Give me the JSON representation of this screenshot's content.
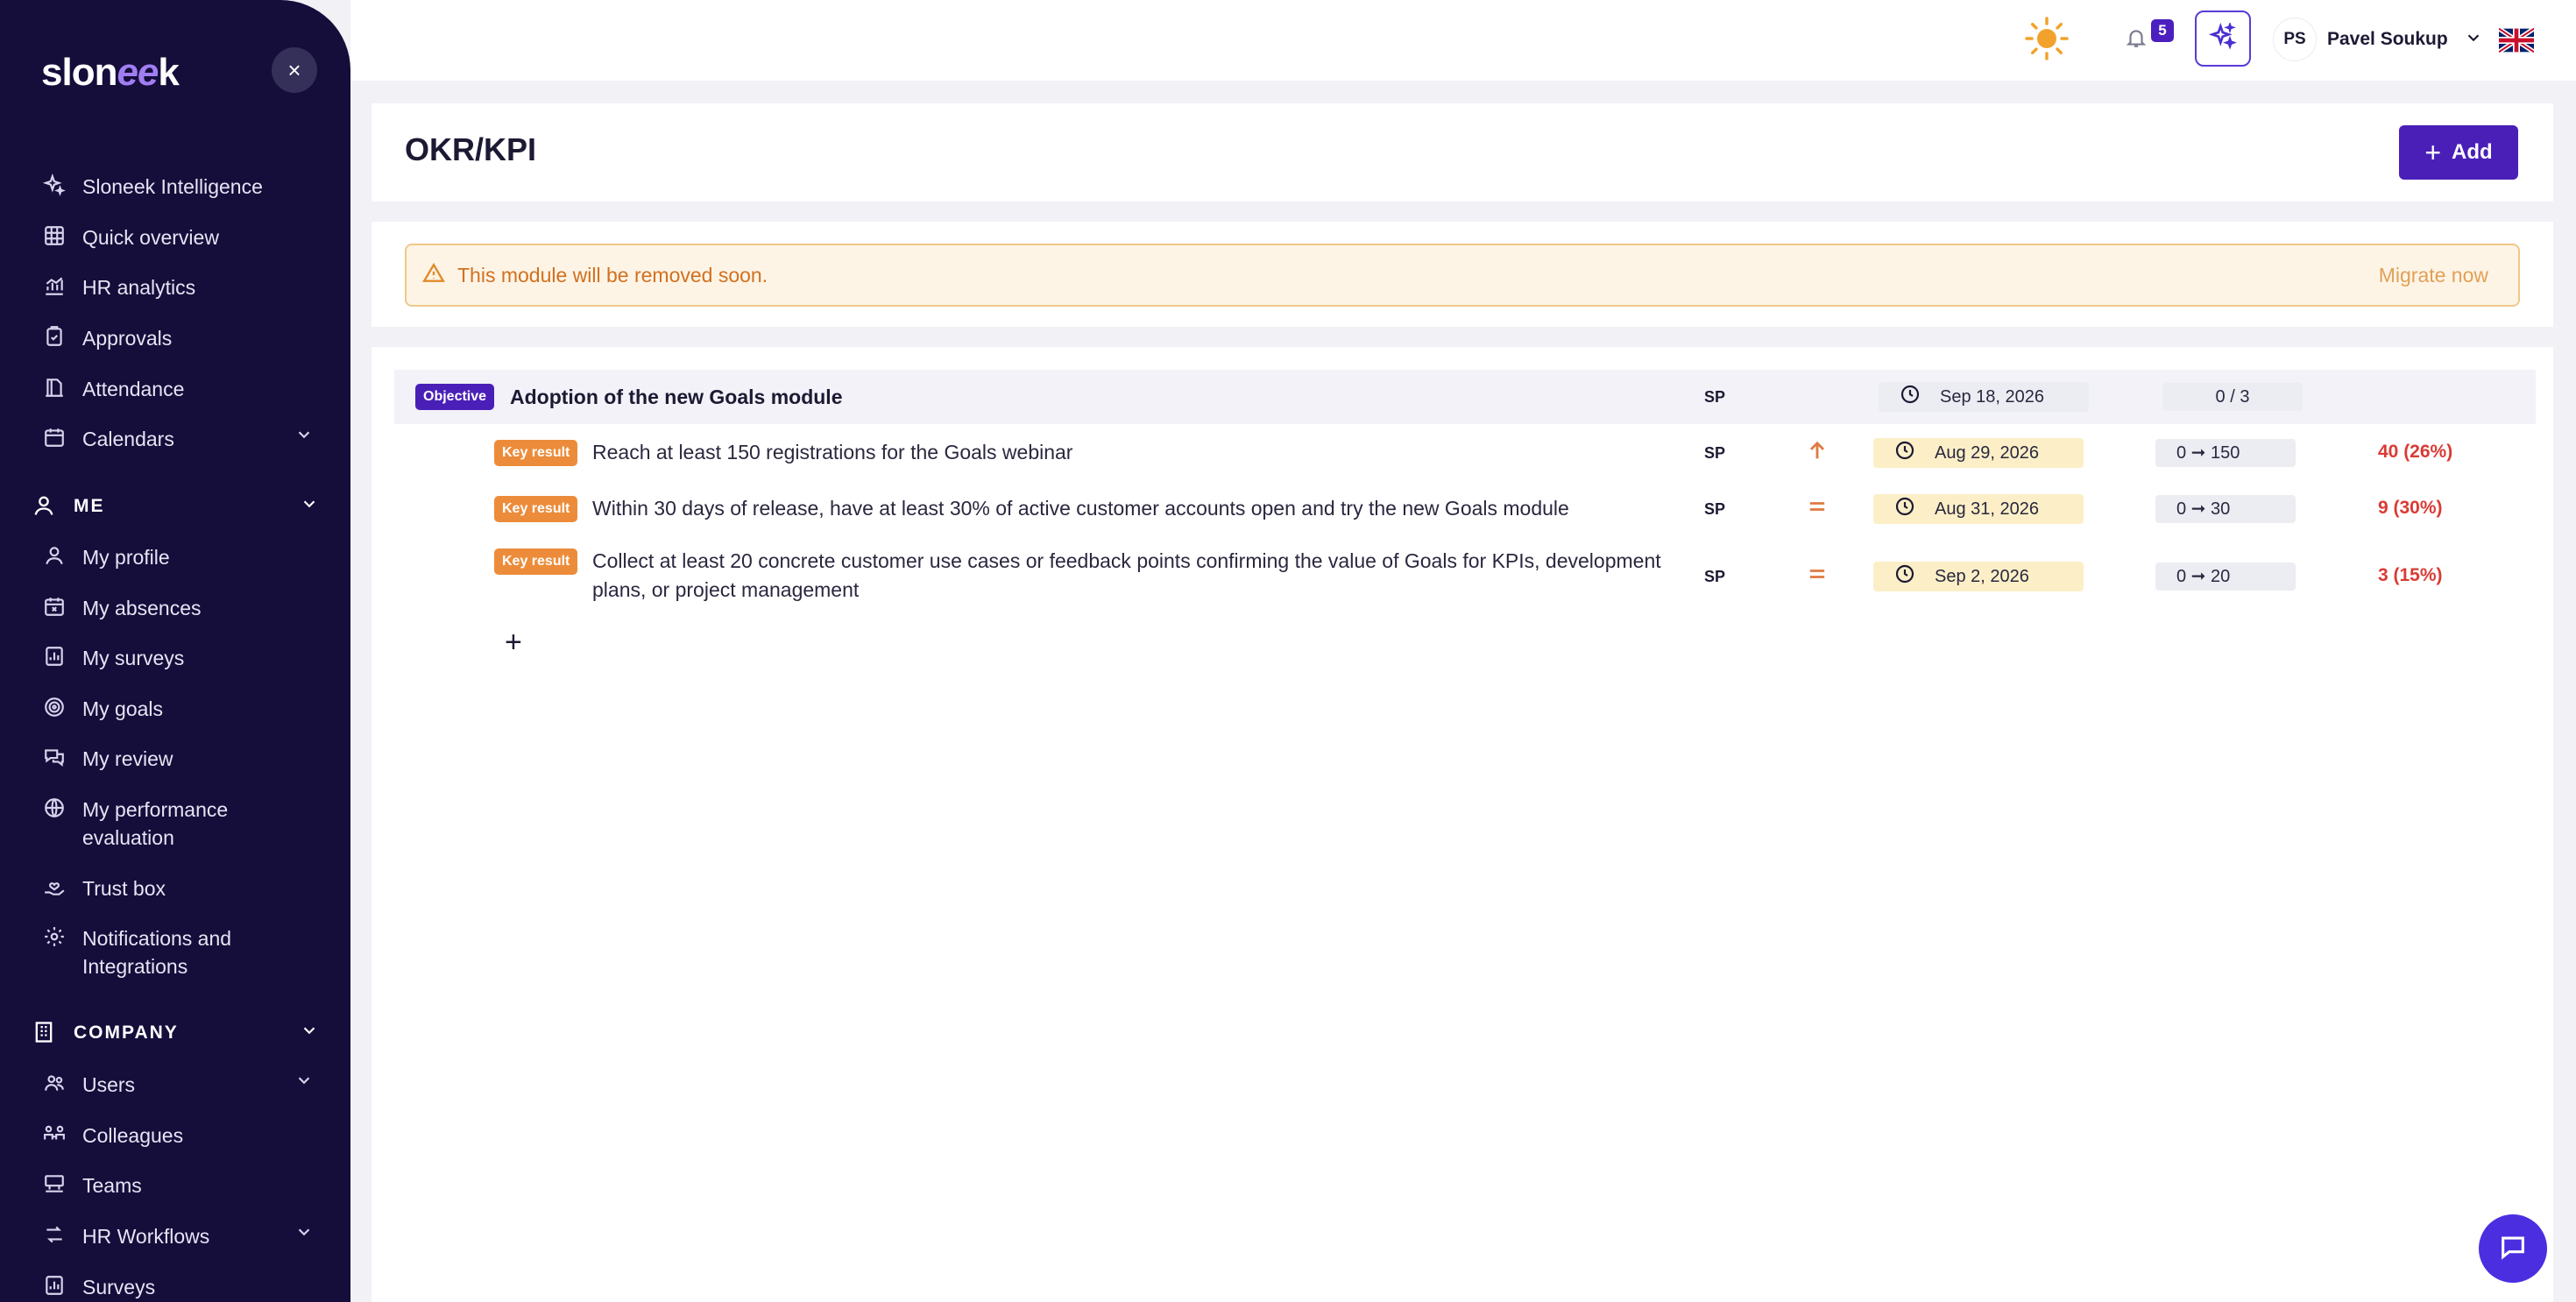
{
  "sidebar": {
    "logo": {
      "left": "slon",
      "mid": "ee",
      "right": "k"
    },
    "close_label": "×",
    "top_items": [
      {
        "label": "Sloneek Intelligence",
        "icon": "sparkle-icon"
      },
      {
        "label": "Quick overview",
        "icon": "grid-icon"
      },
      {
        "label": "HR analytics",
        "icon": "chart-icon"
      },
      {
        "label": "Approvals",
        "icon": "clipboard-check-icon"
      },
      {
        "label": "Attendance",
        "icon": "attendance-icon"
      },
      {
        "label": "Calendars",
        "icon": "calendar-icon"
      }
    ],
    "me_section": "ME",
    "me_items": [
      {
        "label": "My profile",
        "icon": "user-icon"
      },
      {
        "label": "My absences",
        "icon": "calendar-x-icon"
      },
      {
        "label": "My surveys",
        "icon": "survey-icon"
      },
      {
        "label": "My goals",
        "icon": "target-icon"
      },
      {
        "label": "My review",
        "icon": "chat-bubbles-icon"
      },
      {
        "label": "My performance evaluation",
        "icon": "globe-icon"
      },
      {
        "label": "Trust box",
        "icon": "hand-heart-icon"
      },
      {
        "label": "Notifications and Integrations",
        "icon": "gear-icon"
      }
    ],
    "company_section": "COMPANY",
    "company_items": [
      {
        "label": "Users",
        "icon": "users-icon"
      },
      {
        "label": "Colleagues",
        "icon": "colleagues-icon"
      },
      {
        "label": "Teams",
        "icon": "teams-icon"
      },
      {
        "label": "HR Workflows",
        "icon": "workflow-icon"
      },
      {
        "label": "Surveys",
        "icon": "survey-icon"
      }
    ]
  },
  "topbar": {
    "notification_count": "5",
    "user_initials": "PS",
    "user_name": "Pavel Soukup"
  },
  "page": {
    "title": "OKR/KPI",
    "add_label": "Add",
    "alert_text": "This module will be removed soon.",
    "migrate_label": "Migrate now"
  },
  "objective": {
    "tag": "Objective",
    "title": "Adoption of the new Goals module",
    "owner": "SP",
    "date": "Sep 18, 2026",
    "progress": "0 / 3"
  },
  "key_results": [
    {
      "tag": "Key result",
      "title": "Reach at least 150 registrations for the Goals webinar",
      "owner": "SP",
      "trend": "up",
      "date": "Aug 29, 2026",
      "range": "0 ➞ 150",
      "current": "40 (26%)"
    },
    {
      "tag": "Key result",
      "title": "Within 30 days of release, have at least 30% of active customer accounts open and try the new Goals module",
      "owner": "SP",
      "trend": "equal",
      "date": "Aug 31, 2026",
      "range": "0 ➞ 30",
      "current": "9 (30%)"
    },
    {
      "tag": "Key result",
      "title": "Collect at least 20 concrete customer use cases or feedback points confirming the value of Goals for KPIs, development plans, or project management",
      "owner": "SP",
      "trend": "equal",
      "date": "Sep 2, 2026",
      "range": "0 ➞ 20",
      "current": "3 (15%)"
    }
  ],
  "add_key_result_label": "+",
  "colors": {
    "sidebar": "#150d3a",
    "accent": "#4a1fb8",
    "keyresult": "#ec8c3a",
    "alert": "#d2701e",
    "danger": "#d93b35"
  }
}
